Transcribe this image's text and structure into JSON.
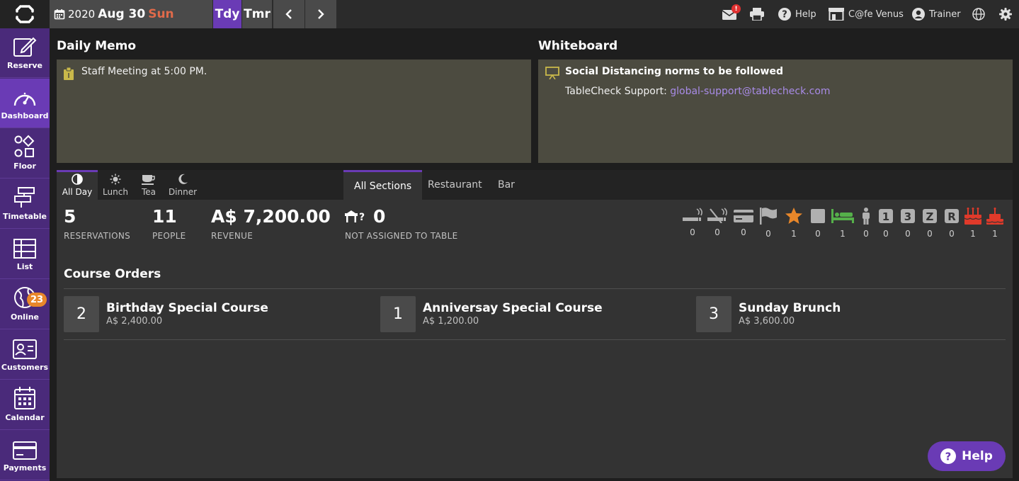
{
  "topbar": {
    "date": {
      "year": "2020",
      "month_day": "Aug 30",
      "weekday": "Sun"
    },
    "today_label": "Tdy",
    "tomorrow_label": "Tmr",
    "mail_badge": "!",
    "help_label": "Help",
    "shop_label": "C@fe Venus",
    "user_label": "Trainer"
  },
  "sidebar": {
    "items": [
      {
        "label": "Reserve",
        "icon": "edit-icon"
      },
      {
        "label": "Dashboard",
        "icon": "speedometer-icon",
        "active": true
      },
      {
        "label": "Floor",
        "icon": "shapes-icon"
      },
      {
        "label": "Timetable",
        "icon": "timetable-icon"
      },
      {
        "label": "List",
        "icon": "list-table-icon"
      },
      {
        "label": "Online",
        "icon": "globe-icon",
        "badge": "23"
      },
      {
        "label": "Customers",
        "icon": "id-card-icon"
      },
      {
        "label": "Calendar",
        "icon": "calendar-icon"
      },
      {
        "label": "Payments",
        "icon": "credit-card-icon"
      }
    ]
  },
  "memo": {
    "title": "Daily Memo",
    "text": "Staff Meeting at 5:00 PM."
  },
  "whiteboard": {
    "title": "Whiteboard",
    "heading": "Social Distancing norms to be followed",
    "support_label": "TableCheck Support: ",
    "support_email": "global-support@tablecheck.com"
  },
  "meal_tabs": [
    {
      "label": "All Day",
      "icon": "half-circle-icon",
      "active": true
    },
    {
      "label": "Lunch",
      "icon": "sun-icon"
    },
    {
      "label": "Tea",
      "icon": "teacup-icon"
    },
    {
      "label": "Dinner",
      "icon": "moon-icon"
    }
  ],
  "section_tabs": [
    {
      "label": "All Sections",
      "active": true
    },
    {
      "label": "Restaurant"
    },
    {
      "label": "Bar"
    }
  ],
  "stats": {
    "reservations": {
      "value": "5",
      "label": "RESERVATIONS"
    },
    "people": {
      "value": "11",
      "label": "PEOPLE"
    },
    "revenue": {
      "value": "A$ 7,200.00",
      "label": "REVENUE"
    },
    "unassigned": {
      "value": "0",
      "label": "NOT ASSIGNED TO TABLE"
    }
  },
  "flags": [
    {
      "icon": "smoking-icon",
      "count": "0"
    },
    {
      "icon": "no-smoking-icon",
      "count": "0"
    },
    {
      "icon": "credit-card-icon",
      "count": "0"
    },
    {
      "icon": "flag-icon",
      "count": "0"
    },
    {
      "icon": "star-icon",
      "count": "1",
      "color": "#e8872a"
    },
    {
      "icon": "square-icon",
      "count": "0"
    },
    {
      "icon": "bed-icon",
      "count": "1",
      "color": "#55b04a"
    },
    {
      "icon": "person-icon",
      "count": "0"
    },
    {
      "icon": "one-badge-icon",
      "count": "0",
      "glyph": "1"
    },
    {
      "icon": "three-badge-icon",
      "count": "0",
      "glyph": "3"
    },
    {
      "icon": "z-badge-icon",
      "count": "0",
      "glyph": "Z"
    },
    {
      "icon": "r-badge-icon",
      "count": "0",
      "glyph": "R"
    },
    {
      "icon": "birthday-cake-icon",
      "count": "1",
      "color": "#e03a2a"
    },
    {
      "icon": "anniversary-cake-icon",
      "count": "1",
      "color": "#e03a2a"
    }
  ],
  "courses": {
    "title": "Course Orders",
    "items": [
      {
        "qty": "2",
        "name": "Birthday Special Course",
        "price": "A$ 2,400.00"
      },
      {
        "qty": "1",
        "name": "Anniversay Special Course",
        "price": "A$ 1,200.00"
      },
      {
        "qty": "3",
        "name": "Sunday Brunch",
        "price": "A$ 3,600.00"
      }
    ]
  },
  "help_fab": {
    "label": "Help"
  },
  "colors": {
    "accent": "#6a3bb5",
    "sidebar": "#4a2a7a",
    "memo_bg": "#4c4b40",
    "weekday": "#e06a4a"
  }
}
